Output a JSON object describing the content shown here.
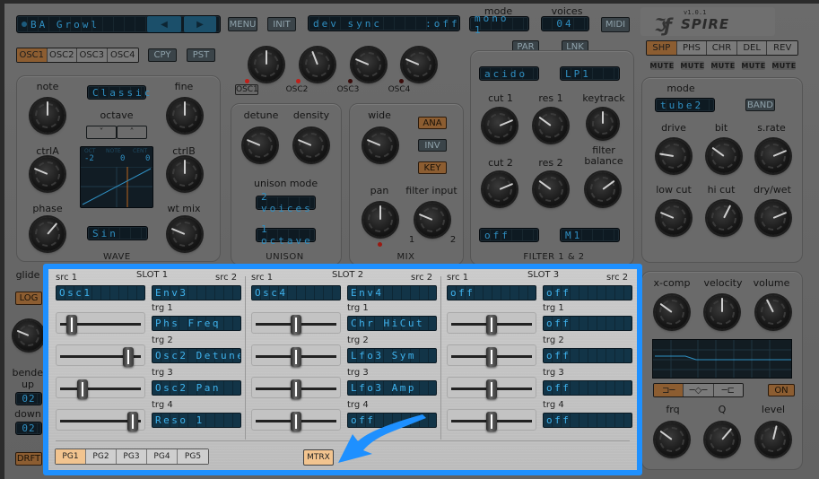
{
  "header": {
    "preset_name": "BA Growl",
    "prev_label": "◀",
    "next_label": "▶",
    "menu_label": "MENU",
    "init_label": "INIT",
    "info_display": "dev sync     :off",
    "mode_label": "mode",
    "mode_value": "mono 1",
    "voices_label": "voices",
    "voices_value": "04",
    "midi_label": "MIDI",
    "logo": "SPIRE",
    "version": "v1.0.1"
  },
  "osc_tabs": {
    "items": [
      "OSC1",
      "OSC2",
      "OSC3",
      "OSC4"
    ],
    "selected": "OSC1",
    "copy_label": "CPY",
    "paste_label": "PST"
  },
  "osc_mix": {
    "knobs": [
      {
        "label": "OSC1",
        "value": 0.5,
        "led": true
      },
      {
        "label": "OSC2",
        "value": 0.42,
        "led": true
      },
      {
        "label": "OSC3",
        "value": 0.25,
        "led": false
      },
      {
        "label": "OSC4",
        "value": 0.25,
        "led": false
      }
    ]
  },
  "oscillator": {
    "note_label": "note",
    "fine_label": "fine",
    "mode_value": "Classic",
    "octave_label": "octave",
    "octave_down": "˅",
    "octave_up": "˄",
    "ctrlA_label": "ctrlA",
    "ctrlB_label": "ctrlB",
    "phase_label": "phase",
    "wtmix_label": "wt mix",
    "display": {
      "oct_label": "OCT",
      "note_label": "NOTE",
      "cent_label": "CENT",
      "oct": "-2",
      "note": "0",
      "cent": "0"
    },
    "wave_value": "Sin",
    "section_title": "WAVE",
    "knobs": {
      "note": 0.5,
      "fine": 0.5,
      "ctrlA": 0.25,
      "ctrlB": 0.5,
      "phase": 0.65,
      "wtmix": 0.25
    }
  },
  "unison": {
    "detune_label": "detune",
    "density_label": "density",
    "mode_label": "unison mode",
    "voices_value": "2 voices",
    "range_value": "1 octave",
    "section_title": "UNISON",
    "knobs": {
      "detune": 0.25,
      "density": 0.25
    }
  },
  "mix": {
    "wide_label": "wide",
    "ana_label": "ANA",
    "inv_label": "INV",
    "key_label": "KEY",
    "pan_label": "pan",
    "filter_input_label": "filter input",
    "filter_input_min": "1",
    "filter_input_max": "2",
    "section_title": "MIX",
    "knobs": {
      "wide": 0.25,
      "pan": 0.5,
      "filter_input": 0.25
    }
  },
  "filter": {
    "par_label": "PAR",
    "lnk_label": "LNK",
    "type1": "acido",
    "type2": "LP1",
    "cut1_label": "cut 1",
    "res1_label": "res 1",
    "keytrack_label": "keytrack",
    "cut2_label": "cut 2",
    "res2_label": "res 2",
    "balance_label": "filter\nbalance",
    "mode1": "off",
    "mode2": "M1",
    "section_title": "FILTER 1 & 2",
    "knobs": {
      "cut1": 0.75,
      "res1": 0.3,
      "keytrack": 0.5,
      "cut2": 0.75,
      "res2": 0.3,
      "balance": 0.7
    }
  },
  "fx": {
    "tabs": [
      "SHP",
      "PHS",
      "CHR",
      "DEL",
      "REV"
    ],
    "selected": "SHP",
    "mute_label": "MUTE",
    "mode_label": "mode",
    "mode_value": "tube2",
    "band_label": "BAND",
    "drive_label": "drive",
    "bit_label": "bit",
    "srate_label": "s.rate",
    "lowcut_label": "low cut",
    "hicut_label": "hi cut",
    "drywet_label": "dry/wet",
    "knobs": {
      "drive": 0.2,
      "bit": 0.3,
      "srate": 0.75,
      "lowcut": 0.25,
      "hicut": 0.6,
      "drywet": 0.75
    }
  },
  "output": {
    "xcomp_label": "x-comp",
    "velocity_label": "velocity",
    "volume_label": "volume",
    "eq_on_label": "ON",
    "eq_modes": [
      "low-shelf",
      "peak",
      "high-shelf"
    ],
    "eq_selected": "low-shelf",
    "frq_label": "frq",
    "q_label": "Q",
    "level_label": "level",
    "knobs": {
      "xcomp": 0.3,
      "velocity": 0.5,
      "volume": 0.4,
      "frq": 0.3,
      "q": 0.65,
      "level": 0.55
    }
  },
  "left_strip": {
    "glide_label": "glide",
    "log_label": "LOG",
    "bender_label": "bender",
    "up_label": "up",
    "up_value": "02",
    "down_label": "down",
    "down_value": "02",
    "drift_label": "DRFT",
    "glide_knob": 0.25
  },
  "matrix": {
    "slots": [
      {
        "title": "SLOT 1",
        "src1_label": "src 1",
        "src2_label": "src 2",
        "src1": "Osc1",
        "src2": "Env3",
        "targets": [
          {
            "label": "trg 1",
            "value": "Phs Freq",
            "amount": 0.14
          },
          {
            "label": "trg 2",
            "value": "Osc2 Detune",
            "amount": 0.84
          },
          {
            "label": "trg 3",
            "value": "Osc2 Pan",
            "amount": 0.28
          },
          {
            "label": "trg 4",
            "value": "Reso 1",
            "amount": 0.9
          }
        ]
      },
      {
        "title": "SLOT 2",
        "src1_label": "src 1",
        "src2_label": "src 2",
        "src1": "Osc4",
        "src2": "Env4",
        "targets": [
          {
            "label": "trg 1",
            "value": "Chr HiCut",
            "amount": 0.5
          },
          {
            "label": "trg 2",
            "value": "Lfo3 Sym",
            "amount": 0.5
          },
          {
            "label": "trg 3",
            "value": "Lfo3 Amp",
            "amount": 0.5
          },
          {
            "label": "trg 4",
            "value": "off",
            "amount": 0.5
          }
        ]
      },
      {
        "title": "SLOT 3",
        "src1_label": "src 1",
        "src2_label": "src 2",
        "src1": "off",
        "src2": "off",
        "targets": [
          {
            "label": "trg 1",
            "value": "off",
            "amount": 0.5
          },
          {
            "label": "trg 2",
            "value": "off",
            "amount": 0.5
          },
          {
            "label": "trg 3",
            "value": "off",
            "amount": 0.5
          },
          {
            "label": "trg 4",
            "value": "off",
            "amount": 0.5
          }
        ]
      }
    ],
    "pages": [
      "PG1",
      "PG2",
      "PG3",
      "PG4",
      "PG5"
    ],
    "selected_page": "PG1",
    "mtrx_label": "MTRX"
  },
  "colors": {
    "highlight": "#1e90ff",
    "accent_orange": "#d9822b",
    "lcd_text": "#3fb3ee",
    "led_red": "#c0201a"
  }
}
